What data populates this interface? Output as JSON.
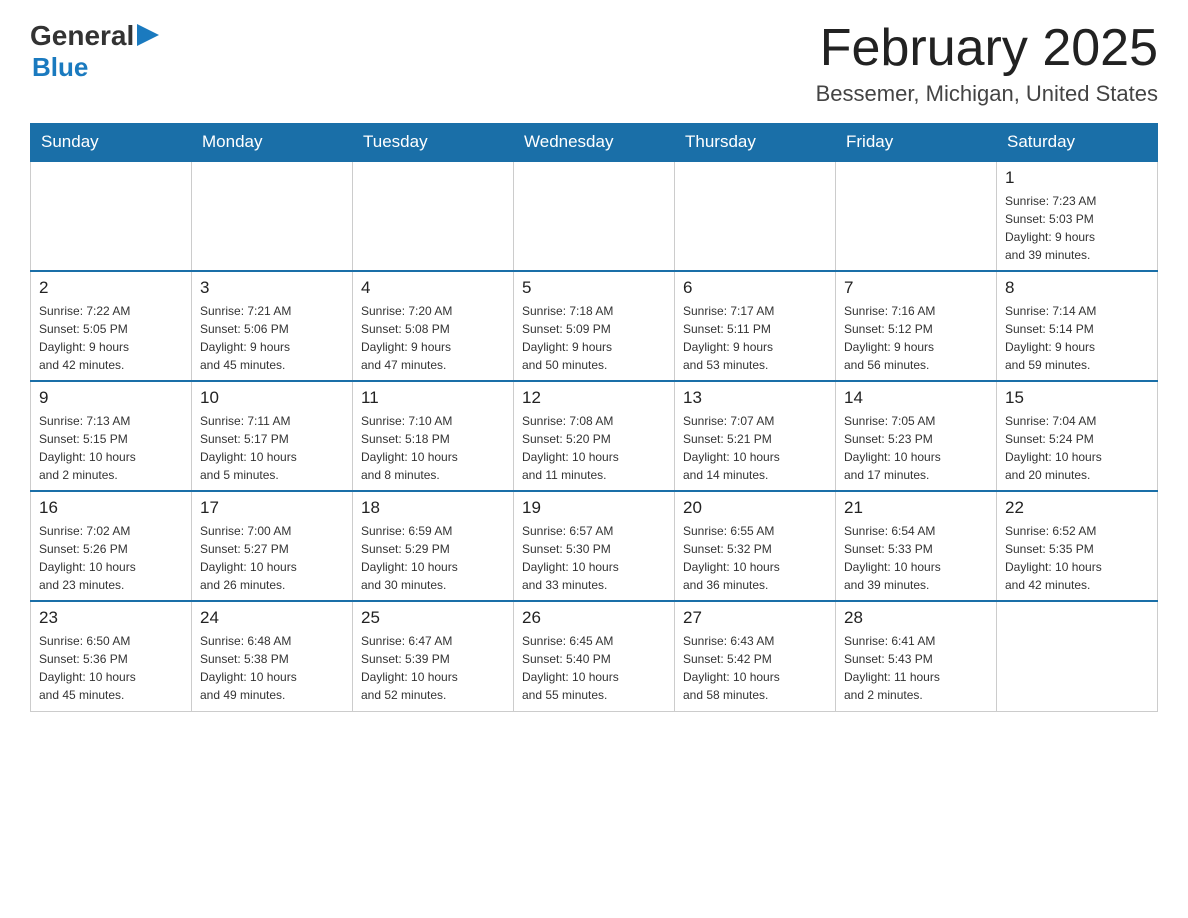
{
  "header": {
    "logo_general": "General",
    "logo_blue": "Blue",
    "month_title": "February 2025",
    "location": "Bessemer, Michigan, United States"
  },
  "days_of_week": [
    "Sunday",
    "Monday",
    "Tuesday",
    "Wednesday",
    "Thursday",
    "Friday",
    "Saturday"
  ],
  "weeks": [
    {
      "days": [
        {
          "number": "",
          "info": ""
        },
        {
          "number": "",
          "info": ""
        },
        {
          "number": "",
          "info": ""
        },
        {
          "number": "",
          "info": ""
        },
        {
          "number": "",
          "info": ""
        },
        {
          "number": "",
          "info": ""
        },
        {
          "number": "1",
          "info": "Sunrise: 7:23 AM\nSunset: 5:03 PM\nDaylight: 9 hours\nand 39 minutes."
        }
      ]
    },
    {
      "days": [
        {
          "number": "2",
          "info": "Sunrise: 7:22 AM\nSunset: 5:05 PM\nDaylight: 9 hours\nand 42 minutes."
        },
        {
          "number": "3",
          "info": "Sunrise: 7:21 AM\nSunset: 5:06 PM\nDaylight: 9 hours\nand 45 minutes."
        },
        {
          "number": "4",
          "info": "Sunrise: 7:20 AM\nSunset: 5:08 PM\nDaylight: 9 hours\nand 47 minutes."
        },
        {
          "number": "5",
          "info": "Sunrise: 7:18 AM\nSunset: 5:09 PM\nDaylight: 9 hours\nand 50 minutes."
        },
        {
          "number": "6",
          "info": "Sunrise: 7:17 AM\nSunset: 5:11 PM\nDaylight: 9 hours\nand 53 minutes."
        },
        {
          "number": "7",
          "info": "Sunrise: 7:16 AM\nSunset: 5:12 PM\nDaylight: 9 hours\nand 56 minutes."
        },
        {
          "number": "8",
          "info": "Sunrise: 7:14 AM\nSunset: 5:14 PM\nDaylight: 9 hours\nand 59 minutes."
        }
      ]
    },
    {
      "days": [
        {
          "number": "9",
          "info": "Sunrise: 7:13 AM\nSunset: 5:15 PM\nDaylight: 10 hours\nand 2 minutes."
        },
        {
          "number": "10",
          "info": "Sunrise: 7:11 AM\nSunset: 5:17 PM\nDaylight: 10 hours\nand 5 minutes."
        },
        {
          "number": "11",
          "info": "Sunrise: 7:10 AM\nSunset: 5:18 PM\nDaylight: 10 hours\nand 8 minutes."
        },
        {
          "number": "12",
          "info": "Sunrise: 7:08 AM\nSunset: 5:20 PM\nDaylight: 10 hours\nand 11 minutes."
        },
        {
          "number": "13",
          "info": "Sunrise: 7:07 AM\nSunset: 5:21 PM\nDaylight: 10 hours\nand 14 minutes."
        },
        {
          "number": "14",
          "info": "Sunrise: 7:05 AM\nSunset: 5:23 PM\nDaylight: 10 hours\nand 17 minutes."
        },
        {
          "number": "15",
          "info": "Sunrise: 7:04 AM\nSunset: 5:24 PM\nDaylight: 10 hours\nand 20 minutes."
        }
      ]
    },
    {
      "days": [
        {
          "number": "16",
          "info": "Sunrise: 7:02 AM\nSunset: 5:26 PM\nDaylight: 10 hours\nand 23 minutes."
        },
        {
          "number": "17",
          "info": "Sunrise: 7:00 AM\nSunset: 5:27 PM\nDaylight: 10 hours\nand 26 minutes."
        },
        {
          "number": "18",
          "info": "Sunrise: 6:59 AM\nSunset: 5:29 PM\nDaylight: 10 hours\nand 30 minutes."
        },
        {
          "number": "19",
          "info": "Sunrise: 6:57 AM\nSunset: 5:30 PM\nDaylight: 10 hours\nand 33 minutes."
        },
        {
          "number": "20",
          "info": "Sunrise: 6:55 AM\nSunset: 5:32 PM\nDaylight: 10 hours\nand 36 minutes."
        },
        {
          "number": "21",
          "info": "Sunrise: 6:54 AM\nSunset: 5:33 PM\nDaylight: 10 hours\nand 39 minutes."
        },
        {
          "number": "22",
          "info": "Sunrise: 6:52 AM\nSunset: 5:35 PM\nDaylight: 10 hours\nand 42 minutes."
        }
      ]
    },
    {
      "days": [
        {
          "number": "23",
          "info": "Sunrise: 6:50 AM\nSunset: 5:36 PM\nDaylight: 10 hours\nand 45 minutes."
        },
        {
          "number": "24",
          "info": "Sunrise: 6:48 AM\nSunset: 5:38 PM\nDaylight: 10 hours\nand 49 minutes."
        },
        {
          "number": "25",
          "info": "Sunrise: 6:47 AM\nSunset: 5:39 PM\nDaylight: 10 hours\nand 52 minutes."
        },
        {
          "number": "26",
          "info": "Sunrise: 6:45 AM\nSunset: 5:40 PM\nDaylight: 10 hours\nand 55 minutes."
        },
        {
          "number": "27",
          "info": "Sunrise: 6:43 AM\nSunset: 5:42 PM\nDaylight: 10 hours\nand 58 minutes."
        },
        {
          "number": "28",
          "info": "Sunrise: 6:41 AM\nSunset: 5:43 PM\nDaylight: 11 hours\nand 2 minutes."
        },
        {
          "number": "",
          "info": ""
        }
      ]
    }
  ]
}
